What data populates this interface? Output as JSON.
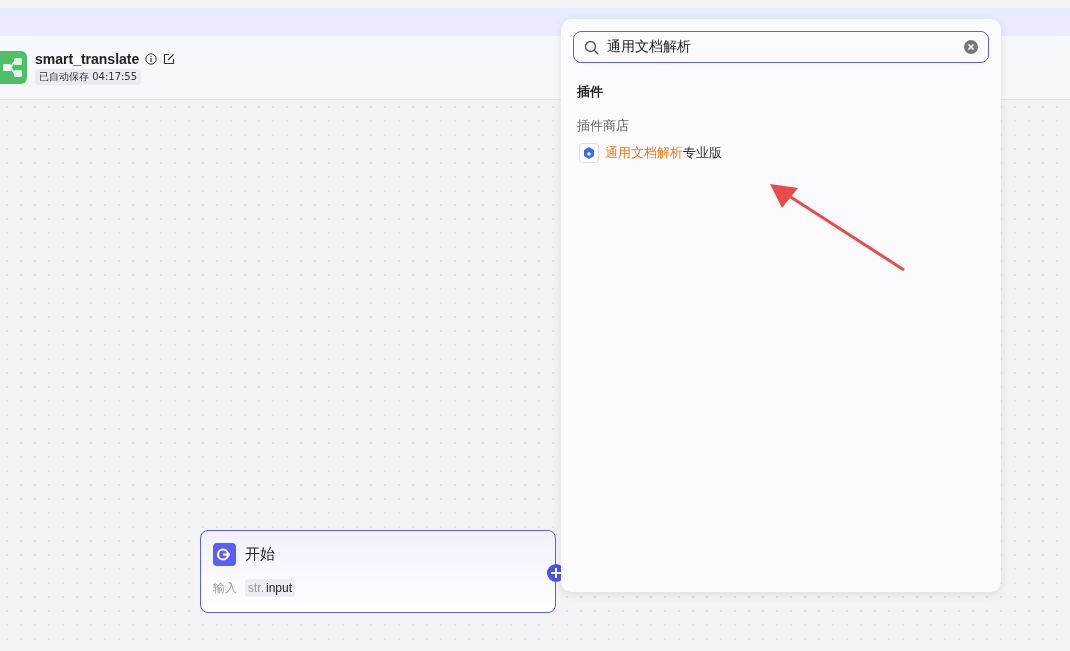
{
  "header": {
    "title": "smart_translate",
    "autosave": "已自动保存 04:17:55"
  },
  "search": {
    "value": "通用文档解析"
  },
  "results": {
    "section": "插件",
    "group": "插件商店",
    "items": [
      {
        "match": "通用文档解析",
        "rest": "专业版"
      }
    ]
  },
  "start_node": {
    "title": "开始",
    "input_label": "输入",
    "param_type": "str.",
    "param_name": "input"
  }
}
